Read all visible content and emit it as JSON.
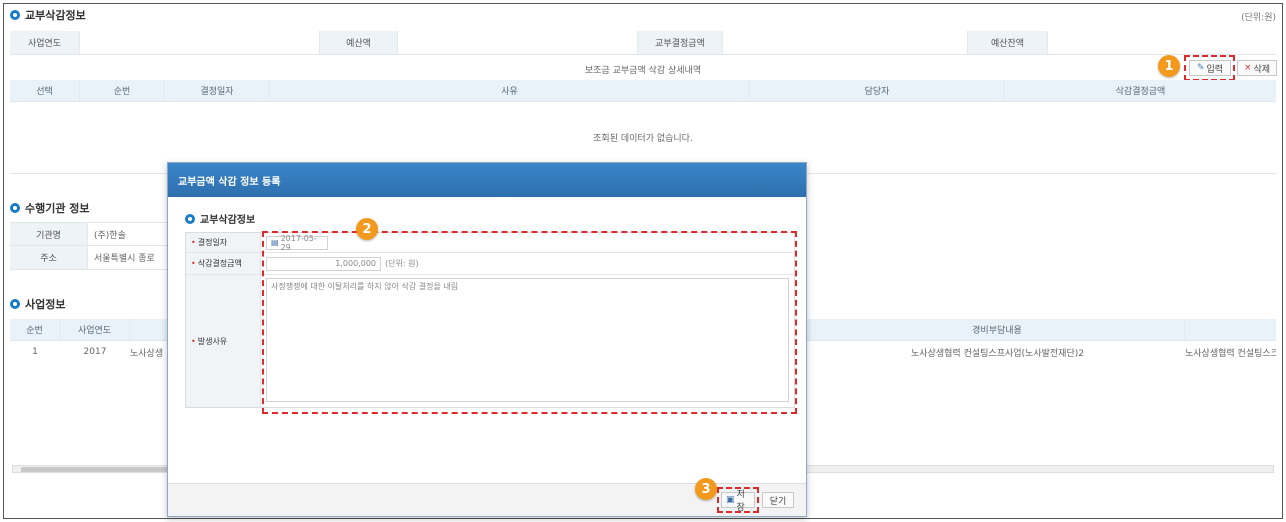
{
  "section1": {
    "title": "교부삭감정보",
    "unit": "(단위:원)"
  },
  "summary": {
    "year_label": "사업연도",
    "budget_label": "예산액",
    "grant_label": "교부결정금액",
    "balance_label": "예산잔액"
  },
  "detail": {
    "caption": "보조금 교부금액 삭감 상세내역",
    "input_button": "입력",
    "delete_button": "삭제",
    "columns": [
      "선택",
      "순번",
      "결정일자",
      "사유",
      "담당자",
      "삭감결정금액"
    ],
    "empty_message": "조회된 데이터가 없습니다."
  },
  "section2": {
    "title": "수행기관 정보",
    "rows": [
      {
        "label": "기관명",
        "value": "(주)한솔"
      },
      {
        "label": "주소",
        "value": "서울특별시 종로"
      }
    ]
  },
  "section3": {
    "title": "사업정보",
    "columns": [
      "순번",
      "사업연도",
      "소",
      "경비부담내용"
    ],
    "rows": [
      {
        "no": "1",
        "year": "2017",
        "name": "노사상생",
        "content": "노사상생협력 컨설팅스프사업(노사발전재단)2",
        "content2": "노사상생협력 컨설팅스크"
      }
    ]
  },
  "modal": {
    "title": "교부금액 삭감 정보 등록",
    "section_title": "교부삭감정보",
    "fields": {
      "date_label": "결정일자",
      "date_value": "2017-05-29",
      "amount_label": "삭감결정금액",
      "amount_value": "1,000,000",
      "amount_unit": "(단위: 원)",
      "reason_label": "발생사유",
      "reason_value": "사정쟁쟁에 대한 이탈처리를 하지 않아 삭감 결정을 내림"
    },
    "save_button": "저장",
    "close_button": "닫기"
  },
  "badges": [
    "1",
    "2",
    "3"
  ],
  "colors": {
    "accent": "#1a7cc7",
    "badge": "#f39a1e",
    "highlight": "#e02a2a",
    "header_bg": "#e9f1f9"
  }
}
